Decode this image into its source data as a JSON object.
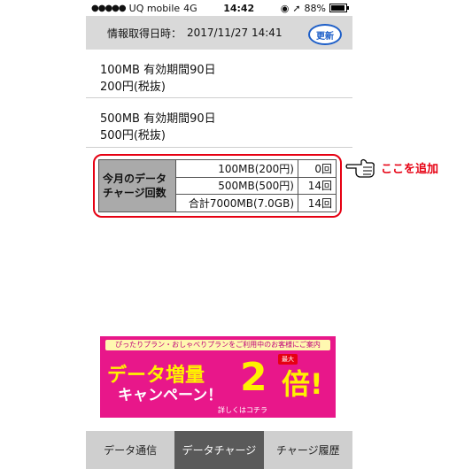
{
  "statusbar": {
    "carrier": "UQ mobile",
    "network": "4G",
    "time": "14:42",
    "battery": "88%"
  },
  "info": {
    "label": "情報取得日時：",
    "datetime": "2017/11/27 14:41",
    "refresh_label": "更新"
  },
  "plans": [
    {
      "line1": "100MB 有効期間90日",
      "line2": "200円(税抜)"
    },
    {
      "line1": "500MB 有効期間90日",
      "line2": "500円(税抜)"
    }
  ],
  "counts": {
    "label": "今月のデータチャージ回数",
    "rows": [
      {
        "amount": "100MB(200円)",
        "count": "0回"
      },
      {
        "amount": "500MB(500円)",
        "count": "14回"
      },
      {
        "amount": "合計7000MB(7.0GB)",
        "count": "14回"
      }
    ]
  },
  "banner": {
    "top_text": "ぴったりプラン・おしゃべりプランをご利用中のお客様にご案内",
    "title": "データ増量",
    "subtitle": "キャンペーン！",
    "max_label": "最大",
    "number": "2",
    "suffix": "倍!",
    "detail": "詳しくはコチラ"
  },
  "tabs": [
    {
      "label": "データ通信",
      "active": false
    },
    {
      "label": "データチャージ",
      "active": true
    },
    {
      "label": "チャージ履歴",
      "active": false
    }
  ],
  "annotation": {
    "text": "ここを追加"
  }
}
